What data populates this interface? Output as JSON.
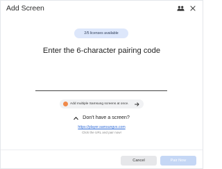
{
  "dialog": {
    "title": "Add Screen"
  },
  "header_icons": [
    {
      "name": "group-icon"
    },
    {
      "name": "close-icon"
    }
  ],
  "licenses": {
    "text": "2/5 licenses available"
  },
  "pairing": {
    "heading": "Enter the 6-character pairing code",
    "code_value": "",
    "code_placeholder": ""
  },
  "multi_screens": {
    "label": "Add multiple Samsung screens at once.",
    "dot_color": "#f08a4b"
  },
  "no_screen": {
    "label": "Don't have a screen?",
    "link": "https://player.samsungvx.com",
    "hint": "Click the URL and pair now!"
  },
  "footer": {
    "cancel_label": "Cancel",
    "pair_label": "Pair Now"
  },
  "colors": {
    "accent_disabled": "#c5d7f5",
    "link": "#2f6bd8",
    "pill_bg": "#dde7fb"
  }
}
